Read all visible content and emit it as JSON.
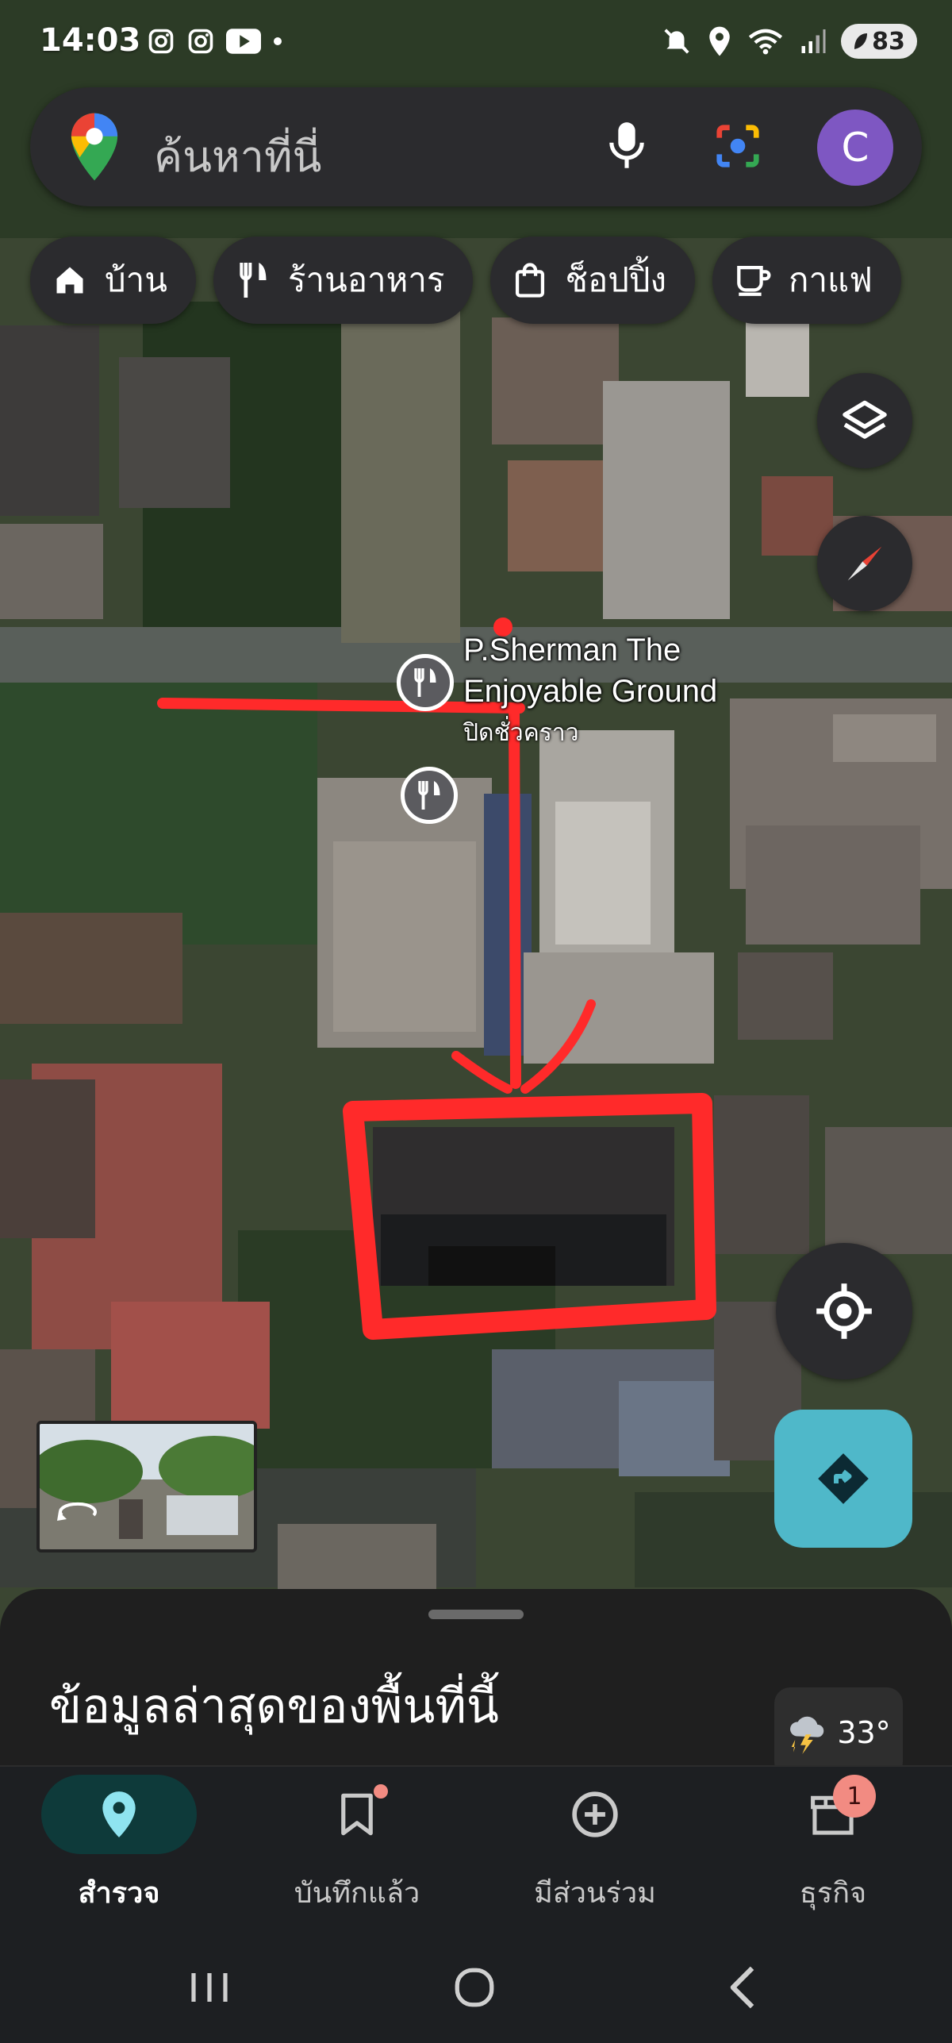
{
  "status_bar": {
    "time": "14:03",
    "battery": "83",
    "left_icons": [
      "instagram-icon",
      "instagram-icon",
      "youtube-icon",
      "dot-icon"
    ],
    "right_icons": [
      "mute-icon",
      "location-icon",
      "wifi-icon",
      "signal-icon",
      "battery-icon"
    ]
  },
  "search": {
    "placeholder": "ค้นหาที่นี่",
    "avatar_letter": "C",
    "avatar_color": "#7e57c2"
  },
  "chips": [
    {
      "label": "บ้าน",
      "icon": "home-icon"
    },
    {
      "label": "ร้านอาหาร",
      "icon": "restaurant-icon"
    },
    {
      "label": "ช็อปปิ้ง",
      "icon": "shopping-bag-icon"
    },
    {
      "label": "กาแฟ",
      "icon": "coffee-icon"
    }
  ],
  "map": {
    "place_name_line1": "P.Sherman The",
    "place_name_line2": "Enjoyable Ground",
    "place_status": "ปิดชั่วคราว",
    "annotation_color": "#ff2a2a"
  },
  "sheet": {
    "title": "ข้อมูลล่าสุดของพื้นที่นี้",
    "weather_temp": "33°"
  },
  "nav": [
    {
      "label": "สำรวจ",
      "icon": "explore-pin-icon",
      "active": true
    },
    {
      "label": "บันทึกแล้ว",
      "icon": "bookmark-icon",
      "active": false
    },
    {
      "label": "มีส่วนร่วม",
      "icon": "add-circle-icon",
      "active": false
    },
    {
      "label": "ธุรกิจ",
      "icon": "business-store-icon",
      "active": false,
      "badge": "1"
    }
  ],
  "colors": {
    "accent_teal": "#4fb8c9",
    "explore_pill": "#0e3a3a",
    "badge": "#f28b82"
  }
}
